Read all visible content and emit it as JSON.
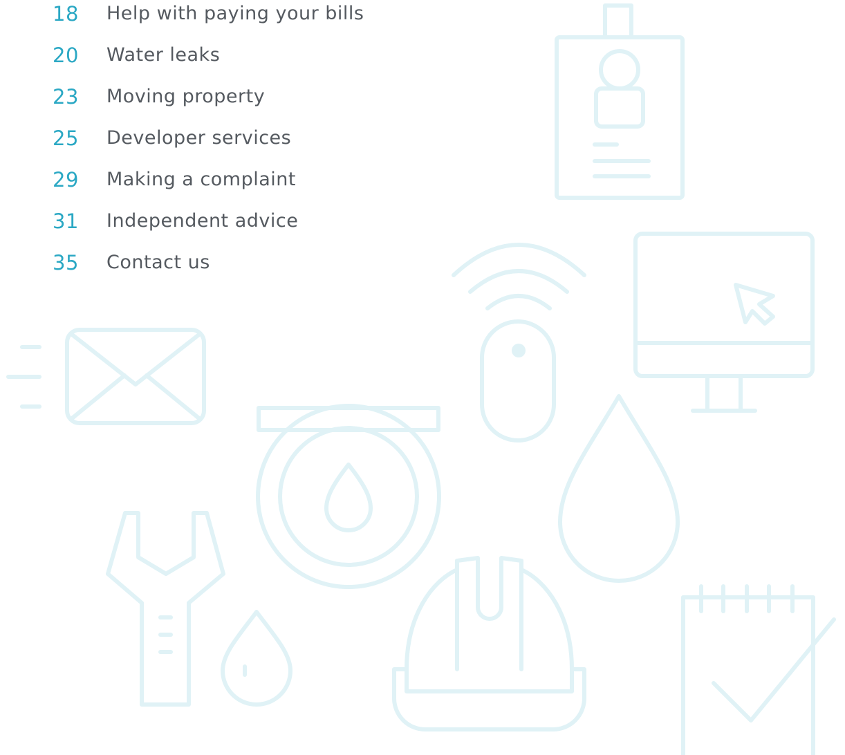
{
  "colors": {
    "page_number": "#2ba8c4",
    "entry_text": "#555a60",
    "illustration_line": "#e0f2f6"
  },
  "contents": [
    {
      "page": "18",
      "title": "Help with paying your bills"
    },
    {
      "page": "20",
      "title": "Water leaks"
    },
    {
      "page": "23",
      "title": "Moving property"
    },
    {
      "page": "25",
      "title": "Developer services"
    },
    {
      "page": "29",
      "title": "Making a complaint"
    },
    {
      "page": "31",
      "title": "Independent advice"
    },
    {
      "page": "35",
      "title": "Contact us"
    }
  ],
  "illustration_icons": [
    "id-badge-icon",
    "computer-monitor-icon",
    "wireless-device-icon",
    "envelope-icon",
    "water-meter-icon",
    "water-drop-icon",
    "wrench-icon",
    "small-water-drop-icon",
    "hard-hat-icon",
    "checklist-notepad-icon"
  ]
}
